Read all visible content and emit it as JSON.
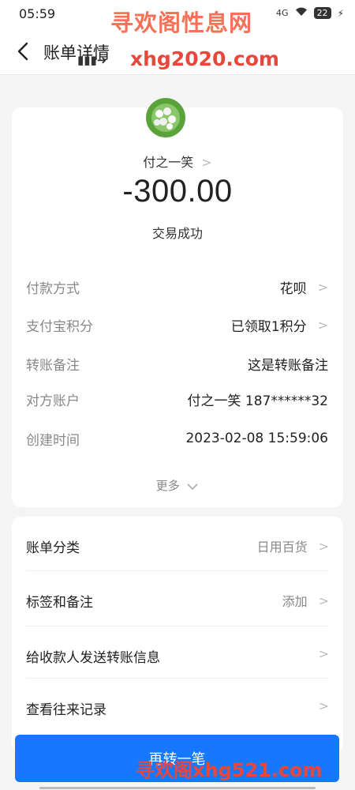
{
  "status_bar": {
    "time": "05:59",
    "network": "4G",
    "battery": "22"
  },
  "header": {
    "title": "账单详情"
  },
  "watermarks": {
    "top": "寻欢阁性息网",
    "url": "xhg2020.com",
    "bottom": "寻欢阁xhg521.com"
  },
  "summary": {
    "payee": "付之一笑",
    "amount": "-300.00",
    "status": "交易成功"
  },
  "details": [
    {
      "label": "付款方式",
      "value": "花呗",
      "has_chevron": true
    },
    {
      "label": "支付宝积分",
      "value": "已领取1积分",
      "has_chevron": true
    },
    {
      "label": "转账备注",
      "value": "这是转账备注",
      "has_chevron": false
    },
    {
      "label": "对方账户",
      "value": "付之一笑 187******32",
      "has_chevron": false
    },
    {
      "label": "创建时间",
      "value": "2023-02-08 15:59:06",
      "has_chevron": false
    }
  ],
  "more_label": "更多",
  "menu": [
    {
      "label": "账单分类",
      "value": "日用百货"
    },
    {
      "label": "标签和备注",
      "value": "添加"
    },
    {
      "label": "给收款人发送转账信息",
      "value": ""
    },
    {
      "label": "查看往来记录",
      "value": ""
    }
  ],
  "bottom_button": {
    "label": "再转一笔"
  },
  "colors": {
    "primary": "#1677ff",
    "watermark": "#e8473c",
    "background": "#f5f5f5"
  }
}
